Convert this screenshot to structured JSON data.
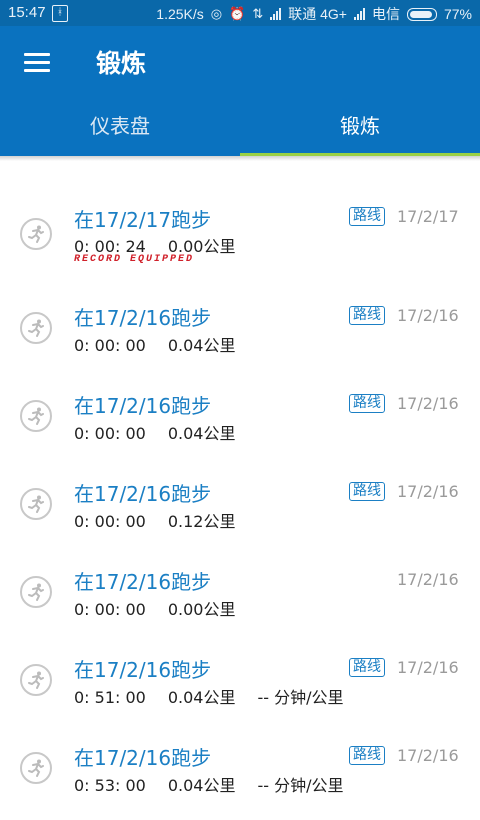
{
  "status_bar": {
    "time": "15:47",
    "speed": "1.25K/s",
    "carrier1": "联通 4G+",
    "carrier2": "电信",
    "battery": "77%"
  },
  "app_bar": {
    "title": "锻炼",
    "tabs": [
      "仪表盘",
      "锻炼"
    ],
    "active_tab": 1
  },
  "workouts": [
    {
      "title": "在17/2/17跑步",
      "duration": "0: 00: 24",
      "distance": "0.00公里",
      "pace": "",
      "route": "路线",
      "date": "17/2/17",
      "logo": "RECORD EQUIPPED"
    },
    {
      "title": "在17/2/16跑步",
      "duration": "0: 00: 00",
      "distance": "0.04公里",
      "pace": "",
      "route": "路线",
      "date": "17/2/16"
    },
    {
      "title": "在17/2/16跑步",
      "duration": "0: 00: 00",
      "distance": "0.04公里",
      "pace": "",
      "route": "路线",
      "date": "17/2/16"
    },
    {
      "title": "在17/2/16跑步",
      "duration": "0: 00: 00",
      "distance": "0.12公里",
      "pace": "",
      "route": "路线",
      "date": "17/2/16"
    },
    {
      "title": "在17/2/16跑步",
      "duration": "0: 00: 00",
      "distance": "0.00公里",
      "pace": "",
      "route": "",
      "date": "17/2/16"
    },
    {
      "title": "在17/2/16跑步",
      "duration": "0: 51: 00",
      "distance": "0.04公里",
      "pace": "-- 分钟/公里",
      "route": "路线",
      "date": "17/2/16"
    },
    {
      "title": "在17/2/16跑步",
      "duration": "0: 53: 00",
      "distance": "0.04公里",
      "pace": "-- 分钟/公里",
      "route": "路线",
      "date": "17/2/16"
    }
  ],
  "colors": {
    "app_bar": "#0a72bf",
    "status_bar": "#0a68a9",
    "tab_indicator": "#9ad044",
    "title_blue": "#1b7fc4"
  }
}
